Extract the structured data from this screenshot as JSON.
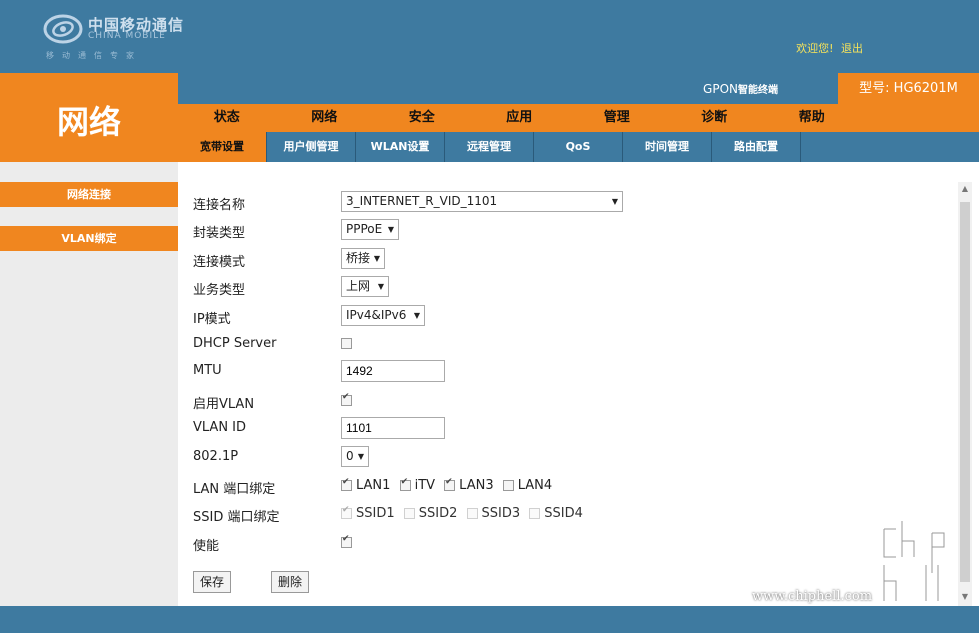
{
  "header": {
    "logo_cn": "中国移动通信",
    "logo_en": "CHINA MOBILE",
    "logo_slogan": "移动通信专家",
    "welcome": "欢迎您!",
    "logout": "退出"
  },
  "left_title": "网络",
  "product": {
    "name_prefix": "GPON",
    "name_suffix": "智能终端",
    "model": "型号: HG6201M"
  },
  "main_nav": [
    "状态",
    "网络",
    "安全",
    "应用",
    "管理",
    "诊断",
    "帮助"
  ],
  "sub_nav": [
    "宽带设置",
    "用户侧管理",
    "WLAN设置",
    "远程管理",
    "QoS",
    "时间管理",
    "路由配置"
  ],
  "sidebar": [
    "网络连接",
    "VLAN绑定"
  ],
  "form": {
    "connection_name": {
      "label": "连接名称",
      "value": "3_INTERNET_R_VID_1101"
    },
    "encap": {
      "label": "封装类型",
      "value": "PPPoE"
    },
    "conn_mode": {
      "label": "连接模式",
      "value": "桥接"
    },
    "service": {
      "label": "业务类型",
      "value": "上网"
    },
    "ip_mode": {
      "label": "IP模式",
      "value": "IPv4&IPv6"
    },
    "dhcp": {
      "label": "DHCP Server",
      "checked": false
    },
    "mtu": {
      "label": "MTU",
      "value": "1492"
    },
    "vlan_enable": {
      "label": "启用VLAN",
      "checked": true
    },
    "vlan_id": {
      "label": "VLAN ID",
      "value": "1101"
    },
    "dot1p": {
      "label": "802.1P",
      "value": "0"
    },
    "lan_bind": {
      "label": "LAN 端口绑定",
      "options": [
        "LAN1",
        "iTV",
        "LAN3",
        "LAN4"
      ]
    },
    "ssid_bind": {
      "label": "SSID 端口绑定",
      "options": [
        "SSID1",
        "SSID2",
        "SSID3",
        "SSID4"
      ]
    },
    "enable": {
      "label": "使能",
      "checked": true
    }
  },
  "buttons": {
    "save": "保存",
    "delete": "删除"
  },
  "watermark": {
    "url": "www.chiphell.com",
    "logo": "chip hell"
  },
  "colors": {
    "orange": "#f0861f",
    "blue": "#3e7aa0",
    "gold_link": "#f4e25b"
  }
}
